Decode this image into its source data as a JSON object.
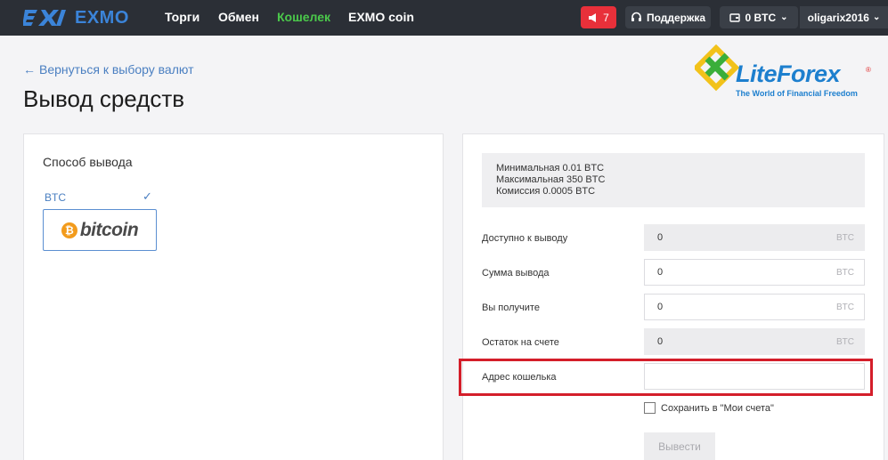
{
  "nav": {
    "logo_text": "EXMO",
    "links": [
      "Торги",
      "Обмен",
      "Кошелек",
      "EXMO coin"
    ],
    "notifications_count": "7",
    "support_label": "Поддержка",
    "balance_label": "0 BTC",
    "username": "oligarix2016",
    "accent_color": "#4bc94b"
  },
  "page": {
    "back_link": "Вернуться к выбору валют",
    "title": "Вывод средств"
  },
  "watermark": {
    "brand": "LiteForex",
    "tagline": "The World of Financial Freedom",
    "registered": "®"
  },
  "method": {
    "title": "Способ вывода",
    "currency": "BTC",
    "card_letter": "₿",
    "card_text": "bitcoin"
  },
  "limits": {
    "min": "Минимальная 0.01 BTC",
    "max": "Максимальная 350 BTC",
    "fee": "Комиссия 0.0005 BTC"
  },
  "form": {
    "rows": [
      {
        "label": "Доступно к выводу",
        "value": "0",
        "unit": "BTC"
      },
      {
        "label": "Сумма вывода",
        "value": "0",
        "unit": "BTC"
      },
      {
        "label": "Вы получите",
        "value": "0",
        "unit": "BTC"
      },
      {
        "label": "Остаток на счете",
        "value": "0",
        "unit": "BTC"
      }
    ],
    "address_label": "Адрес кошелька",
    "address_value": "",
    "save_label": "Сохранить в \"Мои счета\"",
    "submit_label": "Вывести",
    "highlight_color": "#d41e2a"
  }
}
